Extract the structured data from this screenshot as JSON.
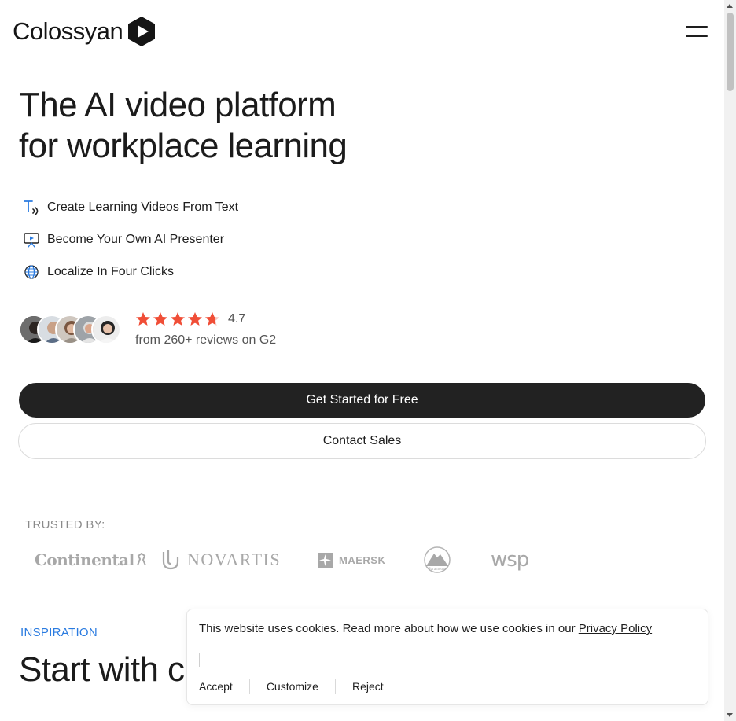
{
  "header": {
    "logo_text": "Colossyan",
    "menu_icon": "hamburger-icon"
  },
  "hero": {
    "title_line1": "The AI video platform",
    "title_line2": "for workplace learning",
    "features": [
      {
        "icon": "text-to-speech-icon",
        "label": "Create Learning Videos From Text"
      },
      {
        "icon": "presenter-icon",
        "label": "Become Your Own AI Presenter"
      },
      {
        "icon": "globe-icon",
        "label": "Localize In Four Clicks"
      }
    ]
  },
  "rating": {
    "score": "4.7",
    "stars": 4.7,
    "reviews_text": "from 260+ reviews on G2",
    "star_color": "#f04e37"
  },
  "cta": {
    "primary": "Get Started for Free",
    "secondary": "Contact Sales"
  },
  "trusted": {
    "label": "TRUSTED BY:",
    "brands": {
      "continental": "Continental",
      "novartis": "NOVARTIS",
      "maersk": "MAERSK",
      "paramount": "Paramount",
      "wsp": "wsp"
    }
  },
  "inspiration": {
    "eyebrow": "INSPIRATION",
    "title": "Start with c"
  },
  "cookie": {
    "text": "This website uses cookies. Read more about how we use cookies in our ",
    "link": "Privacy Policy",
    "accept": "Accept",
    "customize": "Customize",
    "reject": "Reject"
  },
  "colors": {
    "accent_blue": "#2a7be0",
    "primary_button": "#222222"
  }
}
